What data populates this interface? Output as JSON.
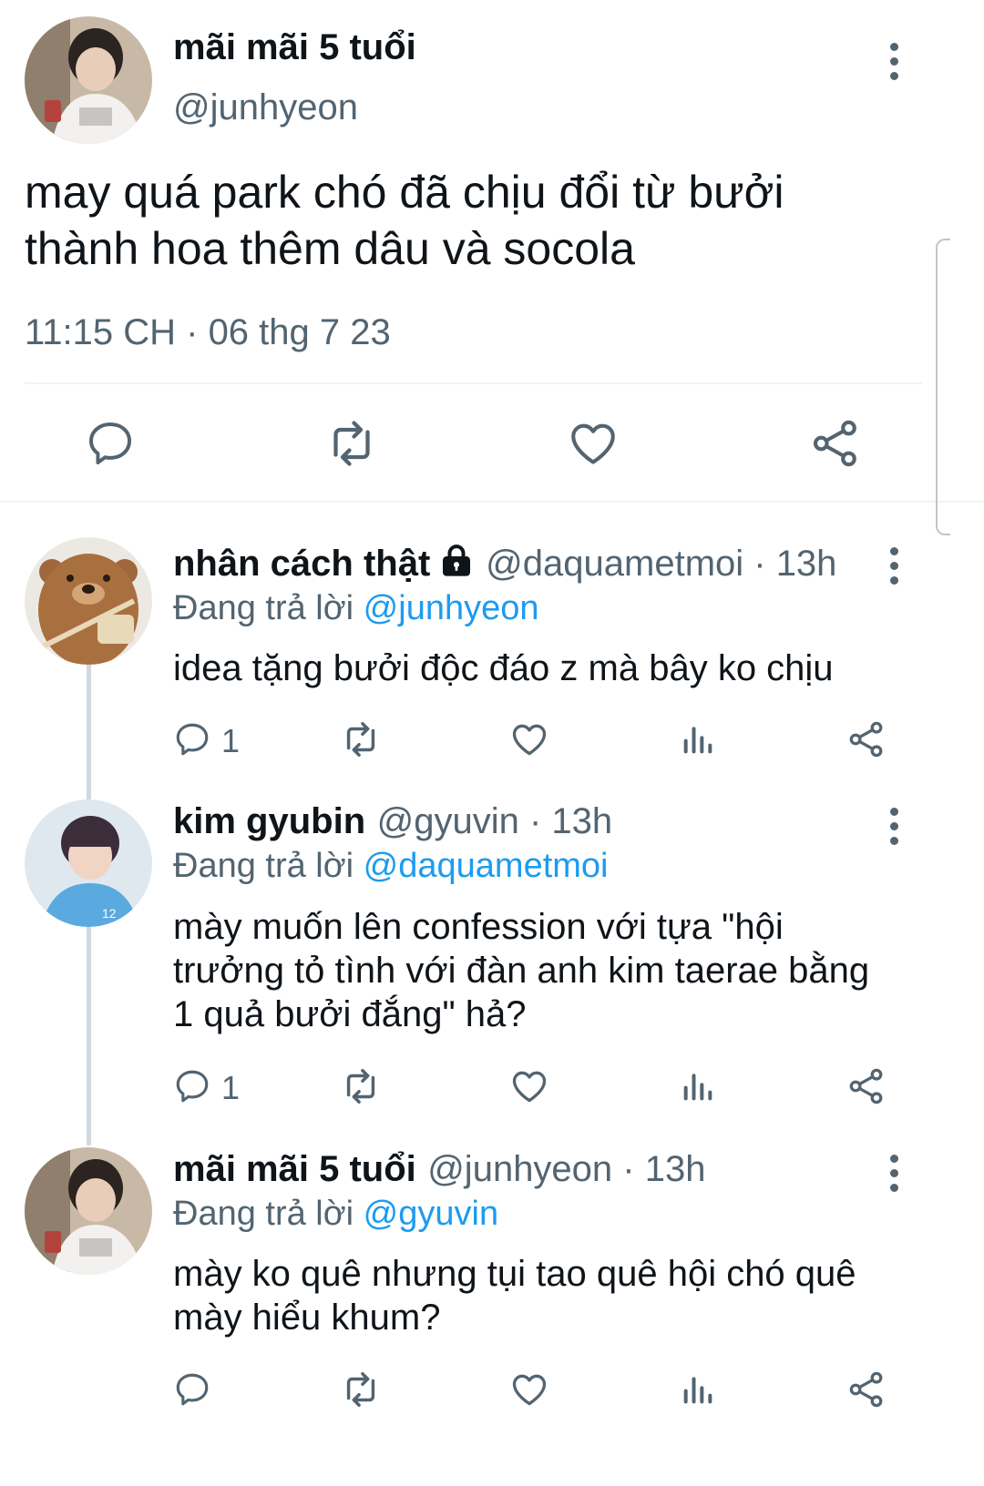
{
  "main_tweet": {
    "display_name": "mãi mãi 5 tuổi",
    "handle": "@junhyeon",
    "text_line1": "may quá park chó đã chịu đổi từ bưởi",
    "text_line2": "thành hoa thêm dâu và socola",
    "timestamp": "11:15 CH · 06 thg 7 23",
    "actions": [
      "reply-icon",
      "retweet-icon",
      "like-icon",
      "share-icon"
    ]
  },
  "replies": [
    {
      "display_name": "nhân cách thật",
      "lock_icon": "lock-icon",
      "meta": "@daquametmoi · 13h",
      "replying_prefix": "Đang trả lời",
      "replying_to": "@junhyeon",
      "text_lines": [
        "idea tặng bưởi độc đáo z mà bây ko chịu"
      ],
      "reply_count": "1"
    },
    {
      "display_name": "kim gyubin",
      "meta": "@gyuvin · 13h",
      "replying_prefix": "Đang trả lời",
      "replying_to": "@daquametmoi",
      "text_lines": [
        "mày muốn lên confession với tựa \"hội",
        "trưởng tỏ tình với đàn anh kim taerae bằng",
        "1 quả bưởi đắng\" hả?"
      ],
      "reply_count": "1"
    },
    {
      "display_name": "mãi mãi 5 tuổi",
      "meta": "@junhyeon · 13h",
      "replying_prefix": "Đang trả lời",
      "replying_to": "@gyuvin",
      "text_lines": [
        "mày ko quê nhưng tụi tao quê hội chó quê",
        "mày hiểu khum?"
      ],
      "reply_count": ""
    }
  ],
  "colors": {
    "link": "#1d9bf0",
    "muted": "#536471",
    "text": "#0f1419",
    "divider": "#eff3f4"
  }
}
